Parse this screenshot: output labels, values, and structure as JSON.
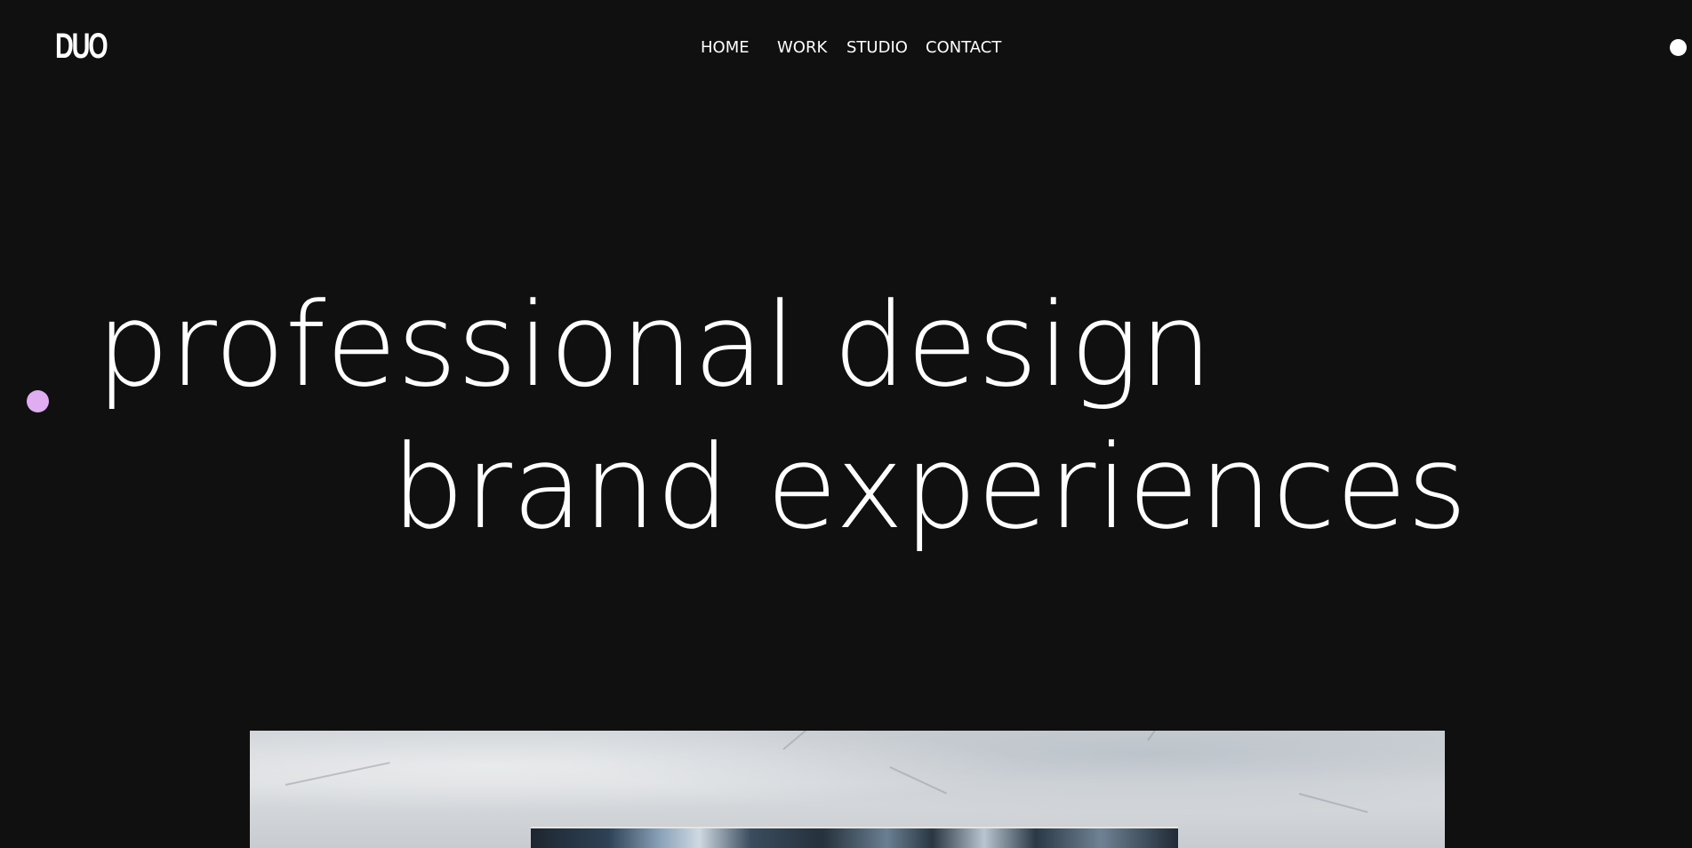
{
  "header": {
    "logo": "DUO",
    "nav": [
      {
        "label": "HOME"
      },
      {
        "label": "WORK"
      },
      {
        "label": "STUDIO"
      },
      {
        "label": "CONTACT"
      }
    ]
  },
  "hero": {
    "line1": "professional design",
    "line2": "brand experiences"
  },
  "colors": {
    "background": "#111011",
    "text": "#ffffff",
    "accent_dot": "#e0aef0"
  },
  "icons": {
    "menu_dot": "white-circle-icon",
    "accent_dot": "lavender-circle-icon"
  }
}
